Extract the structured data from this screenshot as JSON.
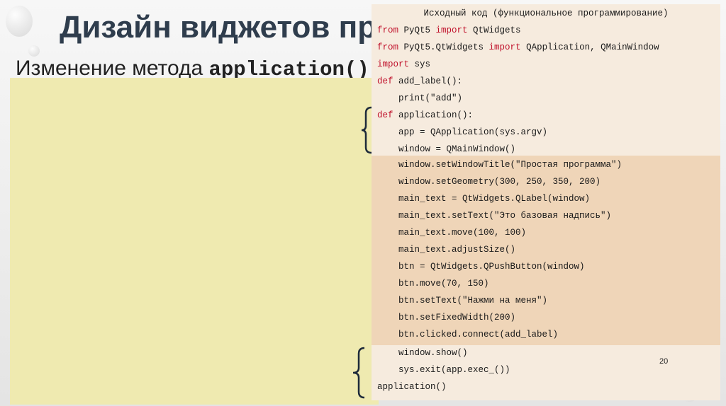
{
  "slide": {
    "title": "Дизайн виджетов при",
    "subtitle_prefix": "Изменение метода",
    "subtitle_method": "application()",
    "page_number": "20"
  },
  "code": {
    "header": "Исходный код (функциональное программирование)",
    "lines": [
      {
        "kw": "from",
        "rest1": " PyQt5 ",
        "kw2": "import",
        "rest2": " QtWidgets"
      },
      {
        "kw": "from",
        "rest1": " PyQt5.QtWidgets ",
        "kw2": "import",
        "rest2": " QApplication, QMainWindow"
      },
      {
        "kw": "import",
        "rest1": " sys"
      },
      {
        "kw": "def",
        "rest1": " add_label():"
      },
      {
        "text": "    print(\"add\")"
      },
      {
        "kw": "def",
        "rest1": " application():"
      },
      {
        "text": "    app = QApplication(sys.argv)"
      },
      {
        "text": "    window = QMainWindow()"
      },
      {
        "text": "    window.setWindowTitle(\"Простая программа\")"
      },
      {
        "text": "    window.setGeometry(300, 250, 350, 200)"
      },
      {
        "text": "    main_text = QtWidgets.QLabel(window)"
      },
      {
        "text": "    main_text.setText(\"Это базовая надпись\")"
      },
      {
        "text": "    main_text.move(100, 100)"
      },
      {
        "text": "    main_text.adjustSize()"
      },
      {
        "text": "    btn = QtWidgets.QPushButton(window)"
      },
      {
        "text": "    btn.move(70, 150)"
      },
      {
        "text": "    btn.setText(\"Нажми на меня\")"
      },
      {
        "text": "    btn.setFixedWidth(200)"
      },
      {
        "text": "    btn.clicked.connect(add_label)"
      },
      {
        "text": "    window.show()"
      },
      {
        "text": "    sys.exit(app.exec_())"
      },
      {
        "text": "application()"
      }
    ]
  },
  "colors": {
    "keyword": "#c0102a",
    "light_bg": "#f6ebde",
    "dark_bg": "#efd5b8",
    "yellow_panel": "#efeab0",
    "title": "#2f3d4d"
  }
}
